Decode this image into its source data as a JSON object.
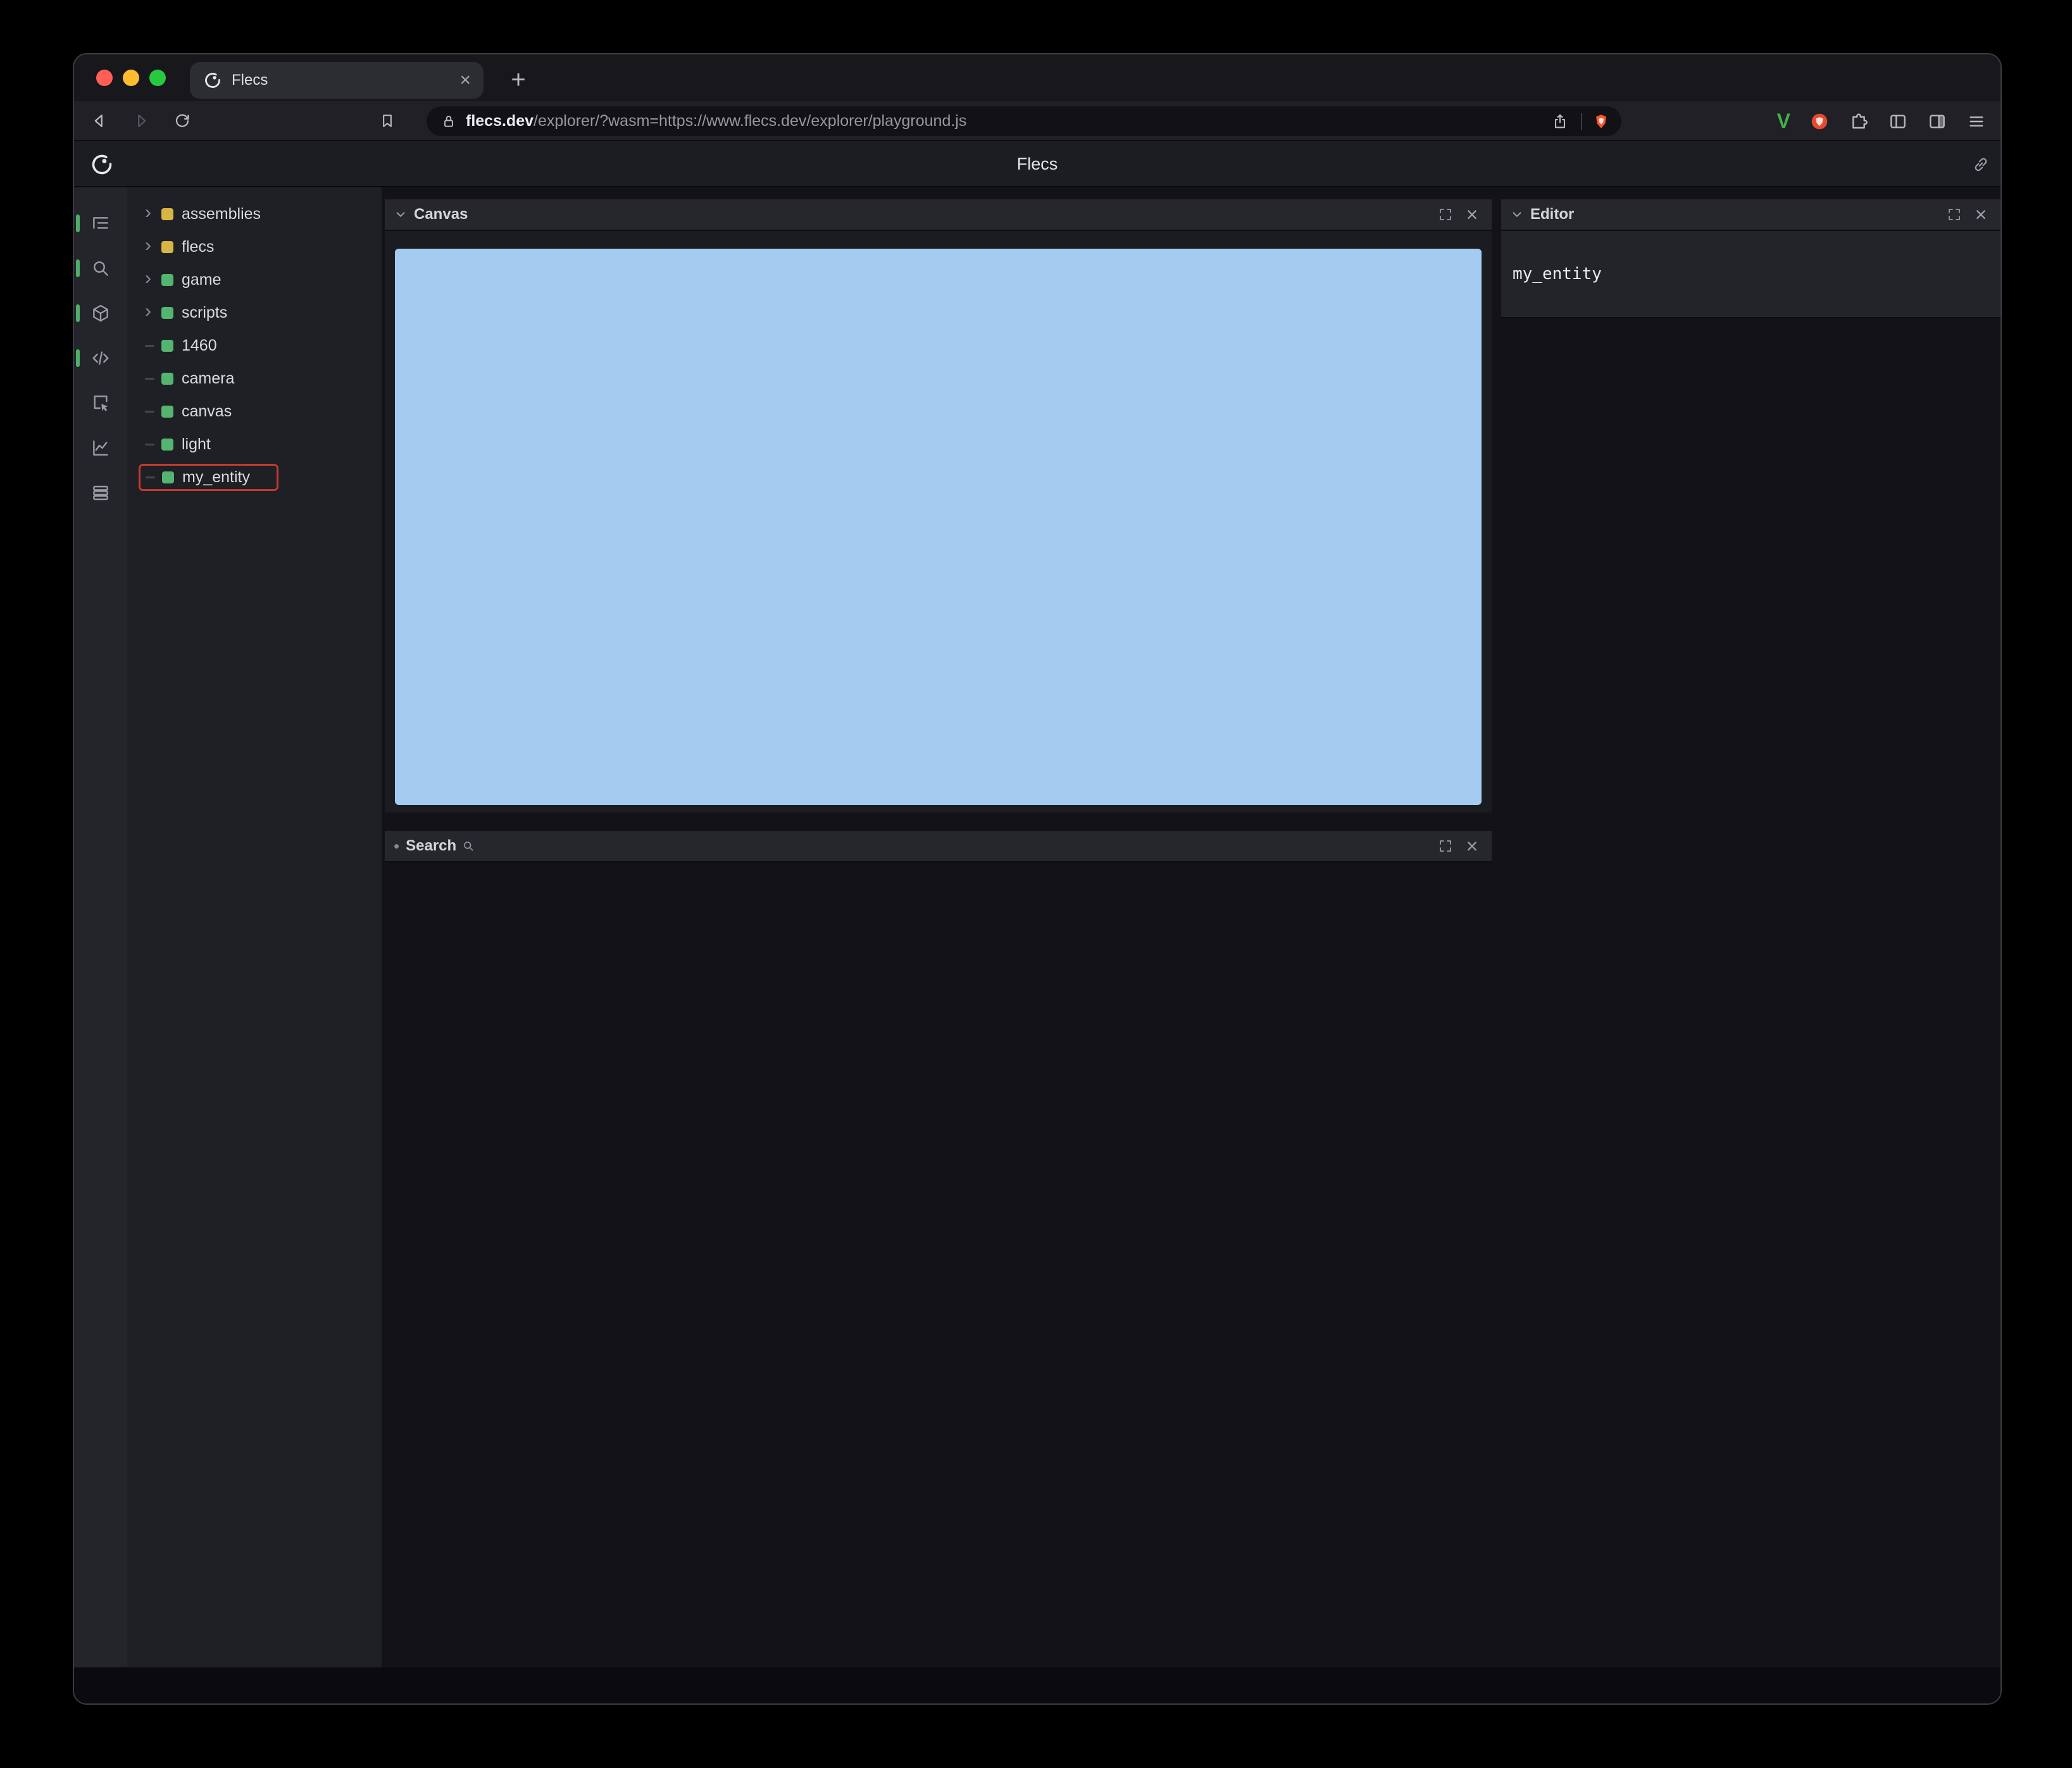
{
  "browser": {
    "tab": {
      "title": "Flecs"
    },
    "address": {
      "domain": "flecs.dev",
      "path": "/explorer/?wasm=https://www.flecs.dev/explorer/playground.js"
    },
    "glyphs": {
      "close_tab": "×",
      "new_tab": "+",
      "vimium": "V"
    }
  },
  "app": {
    "title": "Flecs",
    "glyphs": {
      "close": "×"
    },
    "tree": {
      "expand_glyph": "›",
      "items": [
        {
          "label": "assemblies",
          "icon_color": "#d9b546",
          "expandable": true
        },
        {
          "label": "flecs",
          "icon_color": "#d9b546",
          "expandable": true
        },
        {
          "label": "game",
          "icon_color": "#55b46f",
          "expandable": true
        },
        {
          "label": "scripts",
          "icon_color": "#55b46f",
          "expandable": true
        },
        {
          "label": "1460",
          "icon_color": "#55b46f",
          "expandable": false
        },
        {
          "label": "camera",
          "icon_color": "#55b46f",
          "expandable": false
        },
        {
          "label": "canvas",
          "icon_color": "#55b46f",
          "expandable": false
        },
        {
          "label": "light",
          "icon_color": "#55b46f",
          "expandable": false
        },
        {
          "label": "my_entity",
          "icon_color": "#55b46f",
          "expandable": false,
          "selected": true
        }
      ]
    },
    "panels": {
      "canvas": {
        "title": "Canvas",
        "viewport_color": "#a4ccf1"
      },
      "search": {
        "title": "Search",
        "bullet": "•"
      },
      "editor": {
        "title": "Editor",
        "content": "my_entity"
      }
    },
    "colors": {
      "selection_outline": "#c43b2b",
      "active_indicator": "#4fae68"
    }
  }
}
